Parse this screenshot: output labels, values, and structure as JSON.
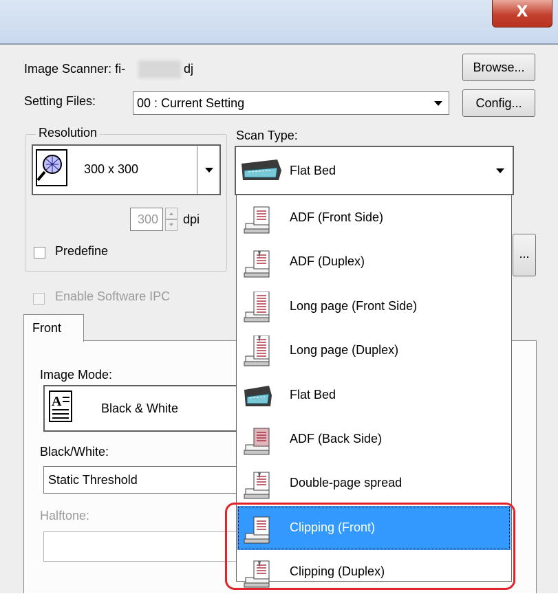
{
  "window": {
    "close_label": "X"
  },
  "scanner": {
    "label": "Image Scanner: fi-",
    "suffix": "dj",
    "browse_label": "Browse..."
  },
  "setting_files": {
    "label": "Setting Files:",
    "value": "00 : Current Setting",
    "config_label": "Config..."
  },
  "resolution": {
    "group_label": "Resolution",
    "value": "300 x 300",
    "dpi_value": "300",
    "dpi_unit": "dpi",
    "predefine_label": "Predefine",
    "predefine_checked": false
  },
  "scan_type": {
    "label": "Scan Type:",
    "value": "Flat Bed",
    "options": [
      {
        "label": "ADF (Front Side)",
        "icon": "adf-front-icon"
      },
      {
        "label": "ADF (Duplex)",
        "icon": "adf-duplex-icon"
      },
      {
        "label": "Long page (Front Side)",
        "icon": "long-page-front-icon"
      },
      {
        "label": "Long page (Duplex)",
        "icon": "long-page-duplex-icon"
      },
      {
        "label": "Flat Bed",
        "icon": "flatbed-icon"
      },
      {
        "label": "ADF (Back Side)",
        "icon": "adf-back-icon"
      },
      {
        "label": "Double-page spread",
        "icon": "double-page-icon"
      },
      {
        "label": "Clipping (Front)",
        "icon": "clipping-front-icon",
        "selected": true
      },
      {
        "label": "Clipping (Duplex)",
        "icon": "clipping-duplex-icon"
      }
    ]
  },
  "partial_button_label": "...",
  "enable_ipc": {
    "label": "Enable Software IPC",
    "checked": false
  },
  "tabs": [
    {
      "label": "Front"
    }
  ],
  "image_mode": {
    "label": "Image Mode:",
    "value": "Black & White"
  },
  "black_white": {
    "label": "Black/White:",
    "value": "Static Threshold"
  },
  "halftone": {
    "label": "Halftone:",
    "value": ""
  },
  "colors": {
    "selection": "#3399ff",
    "highlight": "#e0242a",
    "titlebar": "#c9d9ee"
  }
}
